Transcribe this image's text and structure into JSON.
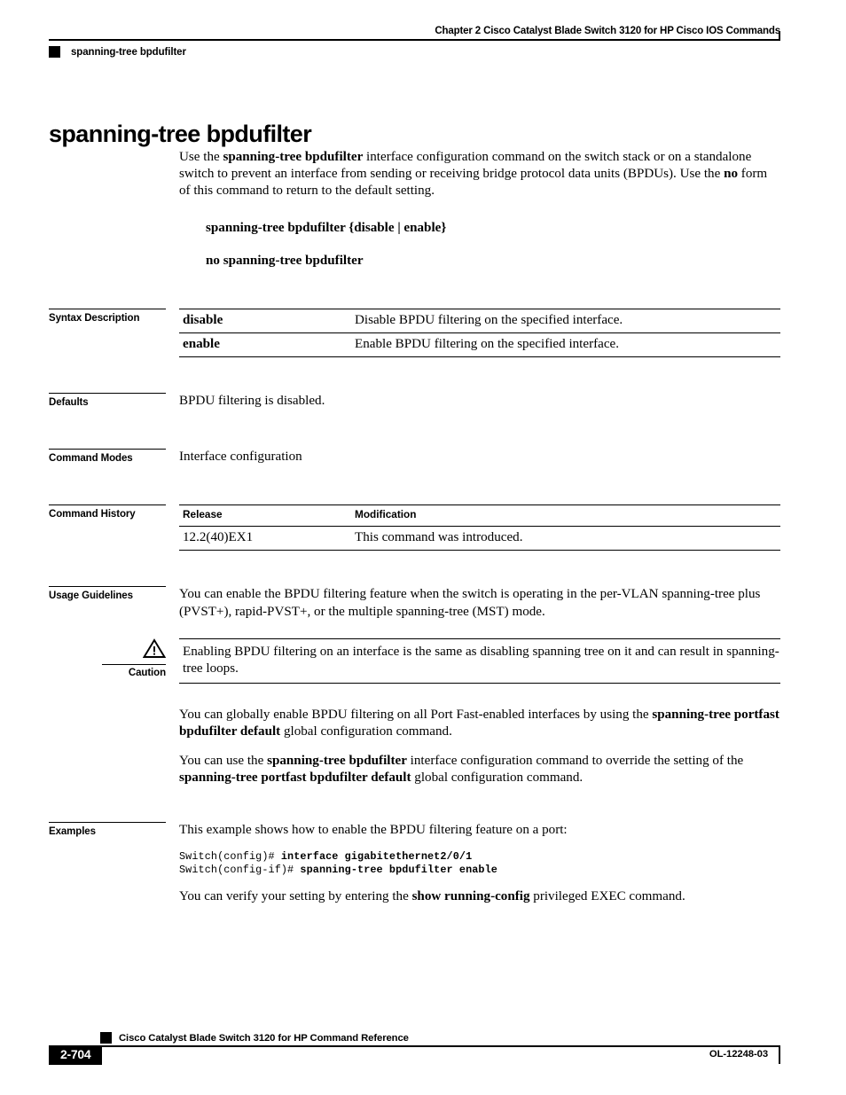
{
  "header": {
    "chapter": "Chapter  2 Cisco Catalyst Blade Switch 3120 for HP Cisco IOS Commands",
    "topic": "spanning-tree bpdufilter"
  },
  "title": "spanning-tree bpdufilter",
  "intro": {
    "part1": "Use the ",
    "cmd1": "spanning-tree bpdufilter",
    "part2": " interface configuration command on the switch stack or on a standalone switch to prevent an interface from sending or receiving bridge protocol data units (BPDUs). Use the ",
    "cmd2": "no",
    "part3": " form of this command to return to the default setting."
  },
  "syntax": {
    "line1": "spanning-tree bpdufilter {disable | enable}",
    "line2": "no spanning-tree bpdufilter"
  },
  "sections": {
    "syntax_description": "Syntax Description",
    "defaults": "Defaults",
    "command_modes": "Command Modes",
    "command_history": "Command History",
    "usage_guidelines": "Usage Guidelines",
    "examples": "Examples"
  },
  "syntax_description_table": {
    "rows": [
      {
        "term": "disable",
        "desc": "Disable BPDU filtering on the specified interface."
      },
      {
        "term": "enable",
        "desc": "Enable BPDU filtering on the specified interface."
      }
    ]
  },
  "defaults_text": "BPDU filtering is disabled.",
  "command_modes_text": "Interface configuration",
  "command_history_table": {
    "headers": {
      "release": "Release",
      "modification": "Modification"
    },
    "rows": [
      {
        "release": "12.2(40)EX1",
        "modification": "This command was introduced."
      }
    ]
  },
  "usage": {
    "para1": "You can enable the BPDU filtering feature when the switch is operating in the per-VLAN spanning-tree plus (PVST+), rapid-PVST+, or the multiple spanning-tree (MST) mode.",
    "caution_label": "Caution",
    "caution_text": "Enabling BPDU filtering on an interface is the same as disabling spanning tree on it and can result in spanning-tree loops.",
    "para2_a": "You can globally enable BPDU filtering on all Port Fast-enabled interfaces by using the ",
    "para2_cmd": "spanning-tree portfast bpdufilter default",
    "para2_b": " global configuration command.",
    "para3_a": "You can use the ",
    "para3_cmd1": "spanning-tree bpdufilter",
    "para3_b": " interface configuration command to override the setting of the ",
    "para3_cmd2": "spanning-tree portfast bpdufilter default",
    "para3_c": " global configuration command."
  },
  "examples": {
    "intro": "This example shows how to enable the BPDU filtering feature on a port:",
    "cli": [
      {
        "prompt": "Switch(config)# ",
        "command": "interface gigabitethernet2/0/1"
      },
      {
        "prompt": "Switch(config-if)# ",
        "command": "spanning-tree bpdufilter enable"
      }
    ],
    "verify_a": "You can verify your setting by entering the ",
    "verify_cmd": "show running-config",
    "verify_b": " privileged EXEC command."
  },
  "footer": {
    "doc_title": "Cisco Catalyst Blade Switch 3120 for HP Command Reference",
    "page_number": "2-704",
    "doc_id": "OL-12248-03"
  }
}
